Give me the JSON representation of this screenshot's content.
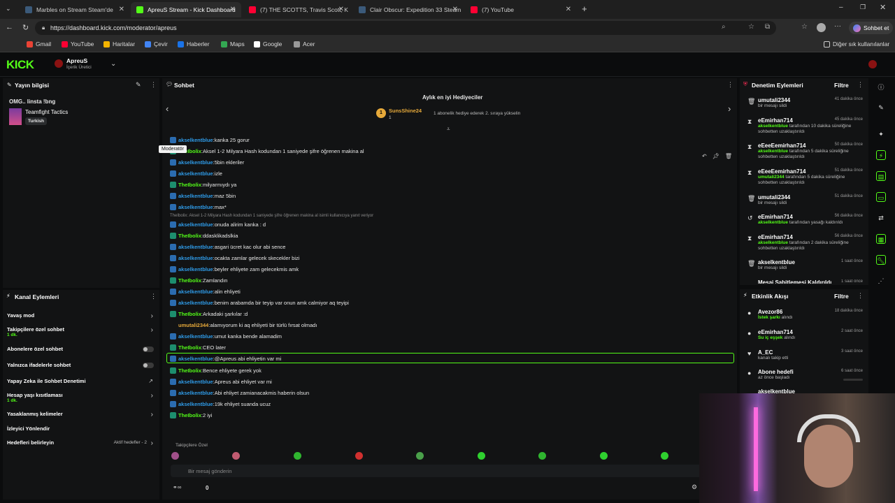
{
  "browser": {
    "tabs": [
      {
        "title": "Marbles on Stream Steam'de",
        "active": false,
        "color": "#3b5a7a"
      },
      {
        "title": "ApreuS Stream - Kick Dashboard",
        "active": true,
        "color": "#53fc18"
      },
      {
        "title": "(7) THE SCOTTS, Travis Scott, K",
        "active": false,
        "color": "#ff0033"
      },
      {
        "title": "Clair Obscur: Expedition 33 Steam",
        "active": false,
        "color": "#3b5a7a"
      },
      {
        "title": "(7) YouTube",
        "active": false,
        "color": "#ff0033"
      }
    ],
    "url": "https://dashboard.kick.com/moderator/apreus",
    "profile_label": "Sohbet et",
    "bookmarks": [
      "Gmail",
      "YouTube",
      "Haritalar",
      "Çevir",
      "Haberler",
      "Maps",
      "Google",
      "Acer"
    ],
    "other_bookmarks": "Diğer sık kullanılanlar"
  },
  "header": {
    "logo": "KICK",
    "user_name": "ApreuS",
    "user_role": "İçerik Üretici"
  },
  "stream_info": {
    "title": "Yayın bilgisi",
    "stream_title": "OMG.. linsta !bng",
    "game": "Teamfight Tactics",
    "language": "Turkish"
  },
  "channel_actions": {
    "title": "Kanal Eylemleri",
    "items": [
      {
        "label": "Yavaş mod",
        "sub": "",
        "control": "chevron"
      },
      {
        "label": "Takipçilere özel sohbet",
        "sub": "1 dk.",
        "control": "chevron"
      },
      {
        "label": "Abonelere özel sohbet",
        "sub": "",
        "control": "toggle"
      },
      {
        "label": "Yalnızca ifadelerle sohbet",
        "sub": "",
        "control": "toggle"
      },
      {
        "label": "Yapay Zeka ile Sohbet Denetimi",
        "sub": "",
        "control": "external"
      },
      {
        "label": "Hesap yaşı kısıtlaması",
        "sub": "1 dk.",
        "control": "chevron"
      },
      {
        "label": "Yasaklanmış kelimeler",
        "sub": "",
        "control": "chevron"
      },
      {
        "label": "İzleyici Yönlendir",
        "sub": "",
        "control": "none"
      },
      {
        "label": "Hedefleri belirleyin",
        "sub": "",
        "control": "chevron",
        "extra": "Aktif hedefler - 2"
      }
    ]
  },
  "chat": {
    "title": "Sohbet",
    "gifters_title": "Aylık en iyi Hediyeciler",
    "top_gifter": "SunsShine24",
    "top_gifter_rank": "1",
    "top_gifter_count": "1",
    "gift_hint": "1 abonelik hediye ederek 2. sıraya yükselin",
    "tooltip": "Moderatör",
    "reply_context": "TheIbolix: Aksel 1-2 Milyara Hash kodundan 1 saniyede şifre öğrenen makina al isimli kullanıcıya yanıt veriyor",
    "messages": [
      {
        "user": "akselkentblue",
        "text": "kanka 25 gorur",
        "color": "blue"
      },
      {
        "user": "TheIbolix",
        "text": "Aksel 1-2 Milyara Hash kodundan 1 saniyede şifre öğrenen makina al",
        "color": "green"
      },
      {
        "user": "akselkentblue",
        "text": "5bin ekleriler",
        "color": "blue"
      },
      {
        "user": "akselkentblue",
        "text": "izle",
        "color": "blue"
      },
      {
        "user": "TheIbolix",
        "text": "milyarmıydı ya",
        "color": "green"
      },
      {
        "user": "akselkentblue",
        "text": "maz 5bin",
        "color": "blue"
      },
      {
        "user": "akselkentblue",
        "text": "max*",
        "color": "blue"
      },
      {
        "user": "akselkentblue",
        "text": "onuda alirim kanka : d",
        "color": "blue"
      },
      {
        "user": "TheIbolix",
        "text": "ddasklikadslkia",
        "color": "green"
      },
      {
        "user": "akselkentblue",
        "text": "asgari ücret kac olur abi sence",
        "color": "blue"
      },
      {
        "user": "akselkentblue",
        "text": "ocakta zamlar gelecek skecekler bizi",
        "color": "blue"
      },
      {
        "user": "akselkentblue",
        "text": "beyler ehliyete zam gelecekmis amk",
        "color": "blue"
      },
      {
        "user": "TheIbolix",
        "text": "Zamlandın",
        "color": "green"
      },
      {
        "user": "akselkentblue",
        "text": "alin ehliyeti",
        "color": "blue"
      },
      {
        "user": "akselkentblue",
        "text": "benim arabamda bir teyip var onun amk calmiyor aq teyipi",
        "color": "blue"
      },
      {
        "user": "TheIbolix",
        "text": "Arkadaki şarkılar :d",
        "color": "green"
      },
      {
        "user": "umutali2344",
        "text": "alamıyorum ki aq ehliyeti bir türlü fırsat olmadı",
        "color": "gold"
      },
      {
        "user": "akselkentblue",
        "text": "umut kanka bende alamadim",
        "color": "blue"
      },
      {
        "user": "TheIbolix",
        "text": "CEO later",
        "color": "green"
      },
      {
        "user": "akselkentblue",
        "text": "@Apreus abi ehliyetin var mi",
        "color": "blue"
      },
      {
        "user": "TheIbolix",
        "text": "Bence ehliyete gerek yok",
        "color": "green"
      },
      {
        "user": "akselkentblue",
        "text": "Apreus abi ehliyet var mi",
        "color": "blue"
      },
      {
        "user": "akselkentblue",
        "text": "Abi ehliyet zamianacakmis haberin olsun",
        "color": "blue"
      },
      {
        "user": "akselkentblue",
        "text": "19k ehliyet suanda ucuz",
        "color": "blue"
      },
      {
        "user": "TheIbolix",
        "text": "2 iyi",
        "color": "green"
      }
    ],
    "followers_only": "Takipçilere Özel",
    "input_placeholder": "Bir mesaj gönderin",
    "viewer_count": "0"
  },
  "mod_actions": {
    "title": "Denetim Eylemleri",
    "filter": "Filtre",
    "items": [
      {
        "user": "umutali2344",
        "pre": "",
        "target": "",
        "desc": "bir mesajı sildi",
        "time": "41 dakika önce",
        "icon": "trash"
      },
      {
        "user": "eEmirhan714",
        "pre": "",
        "target": "akselkentblue",
        "desc": "tarafından 10 dakika süreliğine sohbetten uzaklaştırıldı",
        "time": "45 dakika önce",
        "icon": "hourglass"
      },
      {
        "user": "eEeeEemirhan714",
        "pre": "",
        "target": "akselkentblue",
        "desc": "tarafından 5 dakika süreliğine sohbetten uzaklaştırıldı",
        "time": "50 dakika önce",
        "icon": "hourglass"
      },
      {
        "user": "eEeeEemirhan714",
        "pre": "",
        "target": "umutali2344",
        "desc": "tarafından 5 dakika süreliğine sohbetten uzaklaştırıldı",
        "time": "51 dakika önce",
        "icon": "hourglass"
      },
      {
        "user": "umutali2344",
        "pre": "",
        "target": "",
        "desc": "bir mesajı sildi",
        "time": "51 dakika önce",
        "icon": "trash"
      },
      {
        "user": "eEmirhan714",
        "pre": "",
        "target": "akselkentblue",
        "desc": "tarafından yasağı kaldırıldı",
        "time": "56 dakika önce",
        "icon": "undo"
      },
      {
        "user": "eEmirhan714",
        "pre": "",
        "target": "akselkentblue",
        "desc": "tarafından 2 dakika süreliğine sohbetten uzaklaştırıldı",
        "time": "56 dakika önce",
        "icon": "hourglass"
      },
      {
        "user": "akselkentblue",
        "pre": "",
        "target": "",
        "desc": "bir mesajı sildi",
        "time": "1 saat önce",
        "icon": "trash"
      },
      {
        "user": "Mesaj Sabitlemesi Kaldırıldı",
        "pre": "",
        "target": "",
        "desc": "",
        "time": "1 saat önce",
        "icon": "pin"
      }
    ]
  },
  "activity": {
    "title": "Etkinlik Akışı",
    "filter": "Filtre",
    "items": [
      {
        "user": "Avezor86",
        "hl": "İstek şarkı",
        "desc": "alındı",
        "time": "18 dakika önce"
      },
      {
        "user": "eEmirhan714",
        "hl": "Su iç eşşek",
        "desc": "alındı",
        "time": "2 saat önce"
      },
      {
        "user": "A_EC",
        "hl": "",
        "desc": "kanalı takip etti",
        "time": "3 saat önce"
      },
      {
        "user": "Abone hedefi",
        "hl": "",
        "desc": "az önce başladı",
        "time": "6 saat önce"
      },
      {
        "user": "akselkentblue",
        "hl": "",
        "desc": "",
        "time": ""
      }
    ]
  }
}
